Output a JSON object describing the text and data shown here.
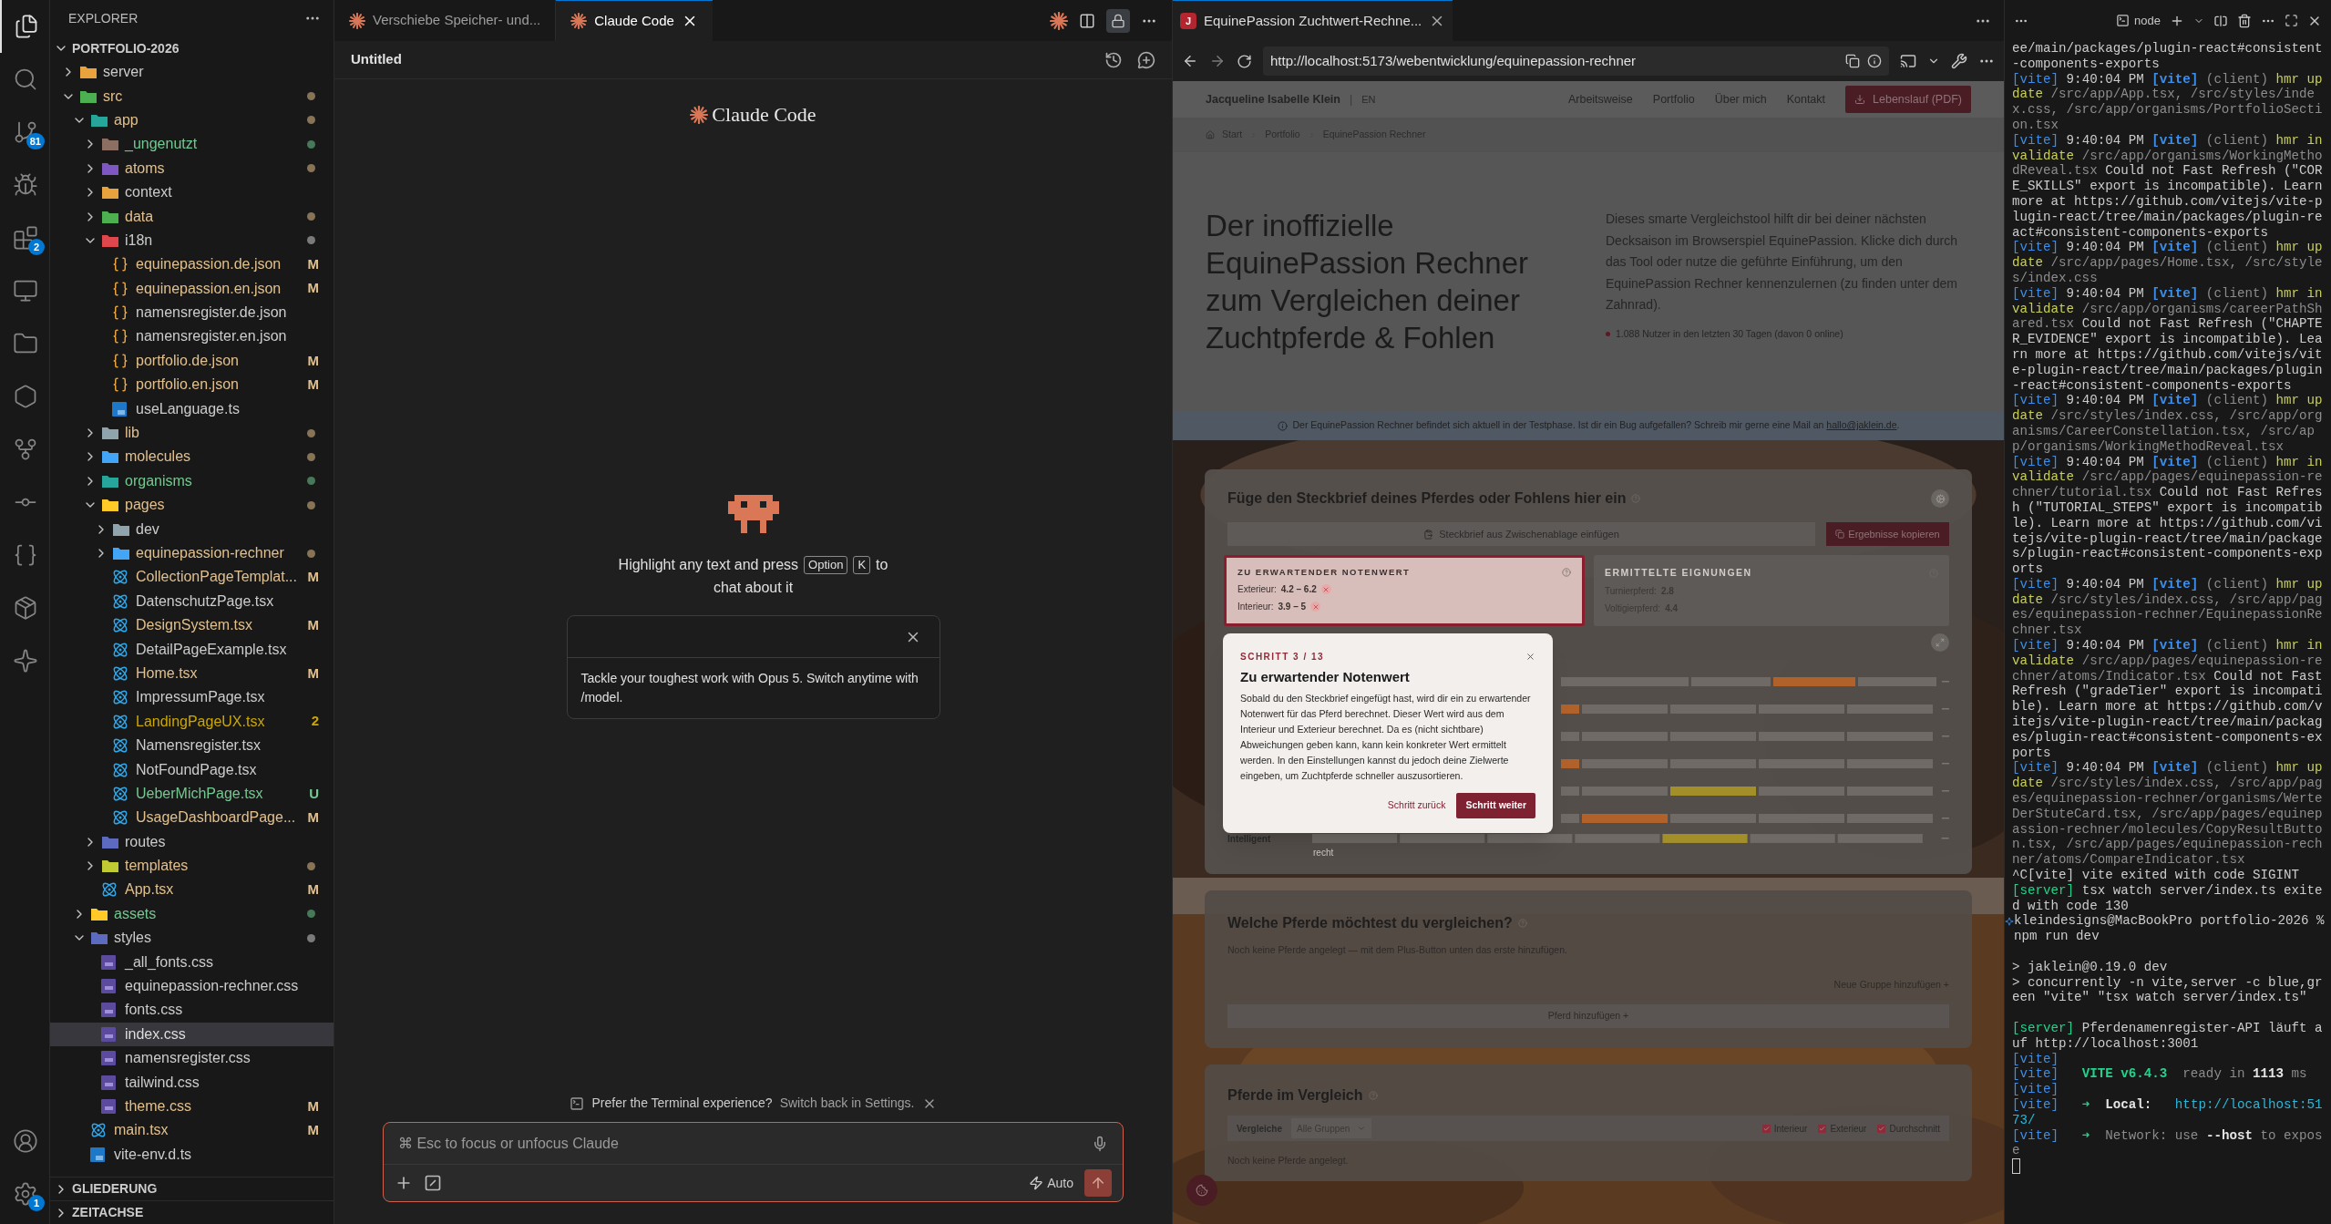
{
  "activity_bar": {
    "items": [
      {
        "kind": "files",
        "selected": true
      },
      {
        "kind": "search",
        "selected": false
      },
      {
        "kind": "source-control",
        "selected": false,
        "badge": "81"
      },
      {
        "kind": "run",
        "selected": false
      },
      {
        "kind": "extensions",
        "selected": false,
        "badge": "2"
      },
      {
        "kind": "remote",
        "selected": false
      },
      {
        "kind": "folder",
        "selected": false
      },
      {
        "kind": "hexagon",
        "selected": false
      },
      {
        "kind": "git-graph",
        "selected": false
      },
      {
        "kind": "git-history",
        "selected": false
      },
      {
        "kind": "api",
        "selected": false
      },
      {
        "kind": "package",
        "selected": false
      },
      {
        "kind": "spark",
        "selected": false
      }
    ],
    "bottom": [
      {
        "kind": "account",
        "selected": false
      },
      {
        "kind": "settings",
        "selected": false,
        "badge": "1"
      }
    ]
  },
  "explorer": {
    "title": "EXPLORER",
    "root": {
      "label": "PORTFOLIO-2026",
      "expanded": true,
      "children": [
        {
          "name": "server",
          "kind": "folder",
          "expanded": false,
          "color": "#cccccc",
          "dot": false,
          "selected": false
        },
        {
          "name": "src",
          "kind": "folder",
          "expanded": true,
          "color": "#e2c08d",
          "dot": true,
          "selected": false,
          "children": [
            {
              "name": "app",
              "kind": "folder",
              "expanded": true,
              "color": "#e2c08d",
              "dot": true,
              "selected": false,
              "children": [
                {
                  "name": "_ungenutzt",
                  "kind": "folder",
                  "expanded": false,
                  "color": "#73c991",
                  "dot": true,
                  "selected": false
                },
                {
                  "name": "atoms",
                  "kind": "folder",
                  "expanded": false,
                  "color": "#e2c08d",
                  "dot": true,
                  "selected": false
                },
                {
                  "name": "context",
                  "kind": "folder",
                  "expanded": false,
                  "color": "#cccccc",
                  "dot": false,
                  "selected": false
                },
                {
                  "name": "data",
                  "kind": "folder",
                  "expanded": false,
                  "color": "#e2c08d",
                  "dot": true,
                  "selected": false
                },
                {
                  "name": "i18n",
                  "kind": "folder",
                  "expanded": true,
                  "color": "#cccccc",
                  "dot": true,
                  "selected": false,
                  "children": [
                    {
                      "name": "equinepassion.de.json",
                      "kind": "json",
                      "color": "#e2c08d",
                      "badge": "M",
                      "selected": false
                    },
                    {
                      "name": "equinepassion.en.json",
                      "kind": "json",
                      "color": "#e2c08d",
                      "badge": "M",
                      "selected": false
                    },
                    {
                      "name": "namensregister.de.json",
                      "kind": "json",
                      "color": "#cccccc",
                      "selected": false
                    },
                    {
                      "name": "namensregister.en.json",
                      "kind": "json",
                      "color": "#cccccc",
                      "selected": false
                    },
                    {
                      "name": "portfolio.de.json",
                      "kind": "json",
                      "color": "#e2c08d",
                      "badge": "M",
                      "selected": false
                    },
                    {
                      "name": "portfolio.en.json",
                      "kind": "json",
                      "color": "#e2c08d",
                      "badge": "M",
                      "selected": false
                    },
                    {
                      "name": "useLanguage.ts",
                      "kind": "ts",
                      "color": "#cccccc",
                      "selected": false
                    }
                  ]
                },
                {
                  "name": "lib",
                  "kind": "folder",
                  "expanded": false,
                  "color": "#e2c08d",
                  "dot": true,
                  "selected": false
                },
                {
                  "name": "molecules",
                  "kind": "folder",
                  "expanded": false,
                  "color": "#e2c08d",
                  "dot": true,
                  "selected": false
                },
                {
                  "name": "organisms",
                  "kind": "folder",
                  "expanded": false,
                  "color": "#73c991",
                  "dot": true,
                  "selected": false
                },
                {
                  "name": "pages",
                  "kind": "folder",
                  "expanded": true,
                  "color": "#e2c08d",
                  "dot": true,
                  "selected": false,
                  "children": [
                    {
                      "name": "dev",
                      "kind": "folder",
                      "expanded": false,
                      "color": "#cccccc",
                      "dot": false,
                      "selected": false
                    },
                    {
                      "name": "equinepassion-rechner",
                      "kind": "folder",
                      "expanded": false,
                      "color": "#e2c08d",
                      "dot": true,
                      "selected": false
                    },
                    {
                      "name": "CollectionPageTemplat...",
                      "kind": "tsx",
                      "color": "#e2c08d",
                      "badge": "M",
                      "selected": false
                    },
                    {
                      "name": "DatenschutzPage.tsx",
                      "kind": "tsx",
                      "color": "#cccccc",
                      "selected": false
                    },
                    {
                      "name": "DesignSystem.tsx",
                      "kind": "tsx",
                      "color": "#e2c08d",
                      "badge": "M",
                      "selected": false
                    },
                    {
                      "name": "DetailPageExample.tsx",
                      "kind": "tsx",
                      "color": "#cccccc",
                      "selected": false
                    },
                    {
                      "name": "Home.tsx",
                      "kind": "tsx",
                      "color": "#e2c08d",
                      "badge": "M",
                      "selected": false
                    },
                    {
                      "name": "ImpressumPage.tsx",
                      "kind": "tsx",
                      "color": "#cccccc",
                      "selected": false
                    },
                    {
                      "name": "LandingPageUX.tsx",
                      "kind": "tsx",
                      "color": "#cca700",
                      "badge": "2",
                      "selected": false
                    },
                    {
                      "name": "Namensregister.tsx",
                      "kind": "tsx",
                      "color": "#cccccc",
                      "selected": false
                    },
                    {
                      "name": "NotFoundPage.tsx",
                      "kind": "tsx",
                      "color": "#cccccc",
                      "selected": false
                    },
                    {
                      "name": "UeberMichPage.tsx",
                      "kind": "tsx",
                      "color": "#73c991",
                      "badge": "U",
                      "selected": false
                    },
                    {
                      "name": "UsageDashboardPage...",
                      "kind": "tsx",
                      "color": "#e2c08d",
                      "badge": "M",
                      "selected": false
                    }
                  ]
                },
                {
                  "name": "routes",
                  "kind": "folder",
                  "expanded": false,
                  "color": "#cccccc",
                  "dot": false,
                  "selected": false
                },
                {
                  "name": "templates",
                  "kind": "folder",
                  "expanded": false,
                  "color": "#e2c08d",
                  "dot": true,
                  "selected": false
                },
                {
                  "name": "App.tsx",
                  "kind": "tsx",
                  "color": "#e2c08d",
                  "badge": "M",
                  "selected": false
                }
              ]
            },
            {
              "name": "assets",
              "kind": "folder",
              "expanded": false,
              "color": "#73c991",
              "dot": true,
              "selected": false
            },
            {
              "name": "styles",
              "kind": "folder",
              "expanded": true,
              "color": "#cccccc",
              "dot": true,
              "selected": false,
              "children": [
                {
                  "name": "_all_fonts.css",
                  "kind": "css",
                  "color": "#cccccc",
                  "selected": false
                },
                {
                  "name": "equinepassion-rechner.css",
                  "kind": "css",
                  "color": "#cccccc",
                  "selected": false
                },
                {
                  "name": "fonts.css",
                  "kind": "css",
                  "color": "#cccccc",
                  "selected": false
                },
                {
                  "name": "index.css",
                  "kind": "css",
                  "selected": true
                },
                {
                  "name": "namensregister.css",
                  "kind": "css",
                  "color": "#cccccc",
                  "selected": false
                },
                {
                  "name": "tailwind.css",
                  "kind": "css",
                  "color": "#cccccc",
                  "selected": false
                },
                {
                  "name": "theme.css",
                  "kind": "css",
                  "color": "#e2c08d",
                  "badge": "M",
                  "selected": false
                }
              ]
            },
            {
              "name": "main.tsx",
              "kind": "tsx",
              "color": "#e2c08d",
              "badge": "M",
              "selected": false
            },
            {
              "name": "vite-env.d.ts",
              "kind": "ts",
              "color": "#cccccc",
              "selected": false
            }
          ]
        }
      ]
    },
    "sections": [
      {
        "label": "GLIEDERUNG",
        "expanded": false
      },
      {
        "label": "ZEITACHSE",
        "expanded": false
      }
    ]
  },
  "editor_tabs": [
    {
      "label": "Verschiebe Speicher- und...",
      "selected": false
    },
    {
      "label": "Claude Code",
      "selected": true
    }
  ],
  "claude": {
    "title": "Untitled",
    "logo": "Claude Code",
    "hint": {
      "before": "Highlight any text and press",
      "keys": [
        "Option",
        "K"
      ],
      "after": "to",
      "line2": "chat about it"
    },
    "tip": "Tackle your toughest work with Opus 5. Switch anytime with /model.",
    "notice": {
      "text": "Prefer the Terminal experience?",
      "link": "Switch back in Settings."
    },
    "input": {
      "placeholder": "⌘ Esc to focus or unfocus Claude"
    },
    "mode": "Auto"
  },
  "browser": {
    "tab": "EquinePassion Zuchtwert-Rechne...",
    "favicon": "J",
    "url": "http://localhost:5173/webentwicklung/equinepassion-rechner",
    "page": {
      "brand": "Jacqueline Isabelle Klein",
      "separator": "|",
      "language": "EN",
      "nav": [
        "Arbeitsweise",
        "Portfolio",
        "Über mich",
        "Kontakt"
      ],
      "cv_button": "Lebenslauf (PDF)",
      "breadcrumb": [
        "Start",
        "Portfolio",
        "EquinePassion Rechner"
      ],
      "hero_title": "Der inoffizielle EquinePassion Rechner zum Vergleichen deiner Zuchtpferde & Fohlen",
      "hero_text": "Dieses smarte Vergleichstool hilft dir bei deiner nächsten Decksaison im Browserspiel EquinePassion. Klicke dich durch das Tool oder nutze die geführte Einführung, um den EquinePassion Rechner kennenzulernen (zu finden unter dem Zahnrad).",
      "stat": "1.088 Nutzer in den letzten 30 Tagen (davon 0 online)",
      "banner": {
        "text": "Der EquinePassion Rechner befindet sich aktuell in der Testphase. Ist dir ein Bug aufgefallen? Schreib mir gerne eine Mail an",
        "link": "hallo@jaklein.de",
        "end": "."
      },
      "paste_card": {
        "title": "Füge den Steckbrief deines Pferdes oder Fohlens hier ein",
        "paste_button": "Steckbrief aus Zwischenablage einfügen",
        "copy_button": "Ergebnisse kopieren",
        "grade": {
          "title": "ZU ERWARTENDER NOTENWERT",
          "rows": [
            {
              "label": "Exterieur:",
              "value": "4.2 – 6.2"
            },
            {
              "label": "Interieur:",
              "value": "3.9 – 5"
            }
          ]
        },
        "suitability": {
          "title": "ERMITTELTE EIGNUNGEN",
          "rows": [
            {
              "label": "Turnierpferd:",
              "value": "2.8"
            },
            {
              "label": "Voltigierpferd:",
              "value": "4.4"
            }
          ]
        },
        "trait_label": "Intelligent",
        "trait_scale": "recht"
      },
      "tour": {
        "step": "SCHRITT 3 / 13",
        "title": "Zu erwartender Notenwert",
        "body": "Sobald du den Steckbrief eingefügt hast, wird dir ein zu erwartender Notenwert für das Pferd berechnet. Dieser Wert wird aus dem Interieur und Exterieur berechnet. Da es (nicht sichtbare) Abweichungen geben kann, kann kein konkreter Wert ermittelt werden. In den Einstellungen kannst du jedoch deine Zielwerte eingeben, um Zuchtpferde schneller auszusortieren.",
        "back": "Schritt zurück",
        "next": "Schritt weiter"
      },
      "compare_card": {
        "title": "Welche Pferde möchtest du vergleichen?",
        "empty": "Noch keine Pferde angelegt — mit dem Plus-Button unten das erste hinzufügen.",
        "new_group": "Neue Gruppe hinzufügen +",
        "add_horse": "Pferd hinzufügen +"
      },
      "result_card": {
        "title": "Pferde im Vergleich",
        "compare_label": "Vergleiche",
        "select": "Alle Gruppen",
        "filters": [
          {
            "label": "Interieur",
            "checked": true
          },
          {
            "label": "Exterieur",
            "checked": true
          },
          {
            "label": "Durchschnitt",
            "checked": true
          }
        ],
        "empty": "Noch keine Pferde angelegt."
      }
    }
  },
  "terminal": {
    "name": "node",
    "lines": [
      {
        "segments": [
          {
            "kind": "plain",
            "text": "ee/main/packages/plugin-react#consistent-components-exports"
          }
        ]
      },
      {
        "segments": [
          {
            "kind": "vite",
            "text": "[vite]"
          },
          {
            "kind": "plain",
            "text": "9:40:04 PM"
          },
          {
            "kind": "vite-bold",
            "text": "[vite]"
          },
          {
            "kind": "dim",
            "text": "(client)"
          },
          {
            "kind": "hmr",
            "text": "hmr update"
          },
          {
            "kind": "dim",
            "text": "/src/app/App.tsx, /src/styles/index.css, /src/app/organisms/PortfolioSection.tsx"
          }
        ]
      },
      {
        "segments": [
          {
            "kind": "vite",
            "text": "[vite]"
          },
          {
            "kind": "plain",
            "text": "9:40:04 PM"
          },
          {
            "kind": "vite-bold",
            "text": "[vite]"
          },
          {
            "kind": "dim",
            "text": "(client)"
          },
          {
            "kind": "hmr",
            "text": "hmr invalidate"
          },
          {
            "kind": "dim",
            "text": "/src/app/organisms/WorkingMethodReveal.tsx"
          },
          {
            "kind": "plain",
            "text": "Could not Fast Refresh (\"CORE_SKILLS\" export is incompatible). Learn more at https://github.com/vitejs/vite-plugin-react/tree/main/packages/plugin-react#consistent-components-exports"
          }
        ]
      },
      {
        "segments": [
          {
            "kind": "vite",
            "text": "[vite]"
          },
          {
            "kind": "plain",
            "text": "9:40:04 PM"
          },
          {
            "kind": "vite-bold",
            "text": "[vite]"
          },
          {
            "kind": "dim",
            "text": "(client)"
          },
          {
            "kind": "hmr",
            "text": "hmr update"
          },
          {
            "kind": "dim",
            "text": "/src/app/pages/Home.tsx, /src/styles/index.css"
          }
        ]
      },
      {
        "segments": [
          {
            "kind": "vite",
            "text": "[vite]"
          },
          {
            "kind": "plain",
            "text": "9:40:04 PM"
          },
          {
            "kind": "vite-bold",
            "text": "[vite]"
          },
          {
            "kind": "dim",
            "text": "(client)"
          },
          {
            "kind": "hmr",
            "text": "hmr invalidate"
          },
          {
            "kind": "dim",
            "text": "/src/app/organisms/careerPathShared.tsx"
          },
          {
            "kind": "plain",
            "text": "Could not Fast Refresh (\"CHAPTER_EVIDENCE\" export is incompatible). Learn more at https://github.com/vitejs/vite-plugin-react/tree/main/packages/plugin-react#consistent-components-exports"
          }
        ]
      },
      {
        "segments": [
          {
            "kind": "vite",
            "text": "[vite]"
          },
          {
            "kind": "plain",
            "text": "9:40:04 PM"
          },
          {
            "kind": "vite-bold",
            "text": "[vite]"
          },
          {
            "kind": "dim",
            "text": "(client)"
          },
          {
            "kind": "hmr",
            "text": "hmr update"
          },
          {
            "kind": "dim",
            "text": "/src/styles/index.css, /src/app/organisms/CareerConstellation.tsx, /src/app/organisms/WorkingMethodReveal.tsx"
          }
        ]
      },
      {
        "segments": [
          {
            "kind": "vite",
            "text": "[vite]"
          },
          {
            "kind": "plain",
            "text": "9:40:04 PM"
          },
          {
            "kind": "vite-bold",
            "text": "[vite]"
          },
          {
            "kind": "dim",
            "text": "(client)"
          },
          {
            "kind": "hmr",
            "text": "hmr invalidate"
          },
          {
            "kind": "dim",
            "text": "/src/app/pages/equinepassion-rechner/tutorial.tsx"
          },
          {
            "kind": "plain",
            "text": "Could not Fast Refresh (\"TUTORIAL_STEPS\" export is incompatible). Learn more at https://github.com/vitejs/vite-plugin-react/tree/main/packages/plugin-react#consistent-components-exports"
          }
        ]
      },
      {
        "segments": [
          {
            "kind": "vite",
            "text": "[vite]"
          },
          {
            "kind": "plain",
            "text": "9:40:04 PM"
          },
          {
            "kind": "vite-bold",
            "text": "[vite]"
          },
          {
            "kind": "dim",
            "text": "(client)"
          },
          {
            "kind": "hmr",
            "text": "hmr update"
          },
          {
            "kind": "dim",
            "text": "/src/styles/index.css, /src/app/pages/equinepassion-rechner/EquinepassionRechner.tsx"
          }
        ]
      },
      {
        "segments": [
          {
            "kind": "vite",
            "text": "[vite]"
          },
          {
            "kind": "plain",
            "text": "9:40:04 PM"
          },
          {
            "kind": "vite-bold",
            "text": "[vite]"
          },
          {
            "kind": "dim",
            "text": "(client)"
          },
          {
            "kind": "hmr",
            "text": "hmr invalidate"
          },
          {
            "kind": "dim",
            "text": "/src/app/pages/equinepassion-rechner/atoms/Indicator.tsx"
          },
          {
            "kind": "plain",
            "text": "Could not Fast Refresh (\"gradeTier\" export is incompatible). Learn more at https://github.com/vitejs/vite-plugin-react/tree/main/packages/plugin-react#consistent-components-exports"
          }
        ]
      },
      {
        "segments": [
          {
            "kind": "vite",
            "text": "[vite]"
          },
          {
            "kind": "plain",
            "text": "9:40:04 PM"
          },
          {
            "kind": "vite-bold",
            "text": "[vite]"
          },
          {
            "kind": "dim",
            "text": "(client)"
          },
          {
            "kind": "hmr",
            "text": "hmr update"
          },
          {
            "kind": "dim",
            "text": "/src/styles/index.css, /src/app/pages/equinepassion-rechner/organisms/WerteDerStuteCard.tsx, /src/app/pages/equinepassion-rechner/molecules/CopyResultButton.tsx, /src/app/pages/equinepassion-rechner/atoms/CompareIndicator.tsx"
          }
        ]
      },
      {
        "segments": [
          {
            "kind": "plain",
            "text": "^C[vite]"
          },
          {
            "kind": "plain",
            "text": "vite exited with code SIGINT"
          }
        ]
      },
      {
        "segments": [
          {
            "kind": "server",
            "text": "[server]"
          },
          {
            "kind": "plain",
            "text": "tsx watch server/index.ts exited with code 130"
          }
        ]
      },
      {
        "prompt": true,
        "segments": [
          {
            "kind": "plain",
            "text": "kleindesigns@MacBookPro portfolio-2026 % npm run dev"
          }
        ]
      },
      {
        "gap_before": true,
        "segments": [
          {
            "kind": "plain",
            "text": "> jaklein@0.19.0 dev"
          }
        ]
      },
      {
        "segments": [
          {
            "kind": "plain",
            "text": "> concurrently -n vite,server -c blue,green \"vite\" \"tsx watch server/index.ts\""
          }
        ]
      },
      {
        "gap_before": true,
        "segments": [
          {
            "kind": "server",
            "text": "[server]"
          },
          {
            "kind": "plain",
            "text": "Pferdenamenregister-API läuft auf http://localhost:3001"
          }
        ]
      },
      {
        "segments": [
          {
            "kind": "vite",
            "text": "[vite]"
          }
        ]
      },
      {
        "segments": [
          {
            "kind": "vite",
            "text": "[vite]"
          },
          {
            "kind": "green",
            "text": "  VITE v6.4.3"
          },
          {
            "kind": "dim",
            "text": " ready in"
          },
          {
            "kind": "bold",
            "text": "1113"
          },
          {
            "kind": "dim",
            "text": "ms"
          }
        ]
      },
      {
        "segments": [
          {
            "kind": "vite",
            "text": "[vite]"
          }
        ]
      },
      {
        "segments": [
          {
            "kind": "vite",
            "text": "[vite]"
          },
          {
            "kind": "green",
            "text": "  ➜"
          },
          {
            "kind": "bold",
            "text": " Local:"
          },
          {
            "kind": "link",
            "text": "  http://localhost:5173/"
          }
        ]
      },
      {
        "segments": [
          {
            "kind": "vite",
            "text": "[vite]"
          },
          {
            "kind": "green",
            "text": "  ➜"
          },
          {
            "kind": "dim",
            "text": " Network: use"
          },
          {
            "kind": "bold",
            "text": "--host"
          },
          {
            "kind": "dim",
            "text": "to expose"
          }
        ]
      }
    ]
  }
}
